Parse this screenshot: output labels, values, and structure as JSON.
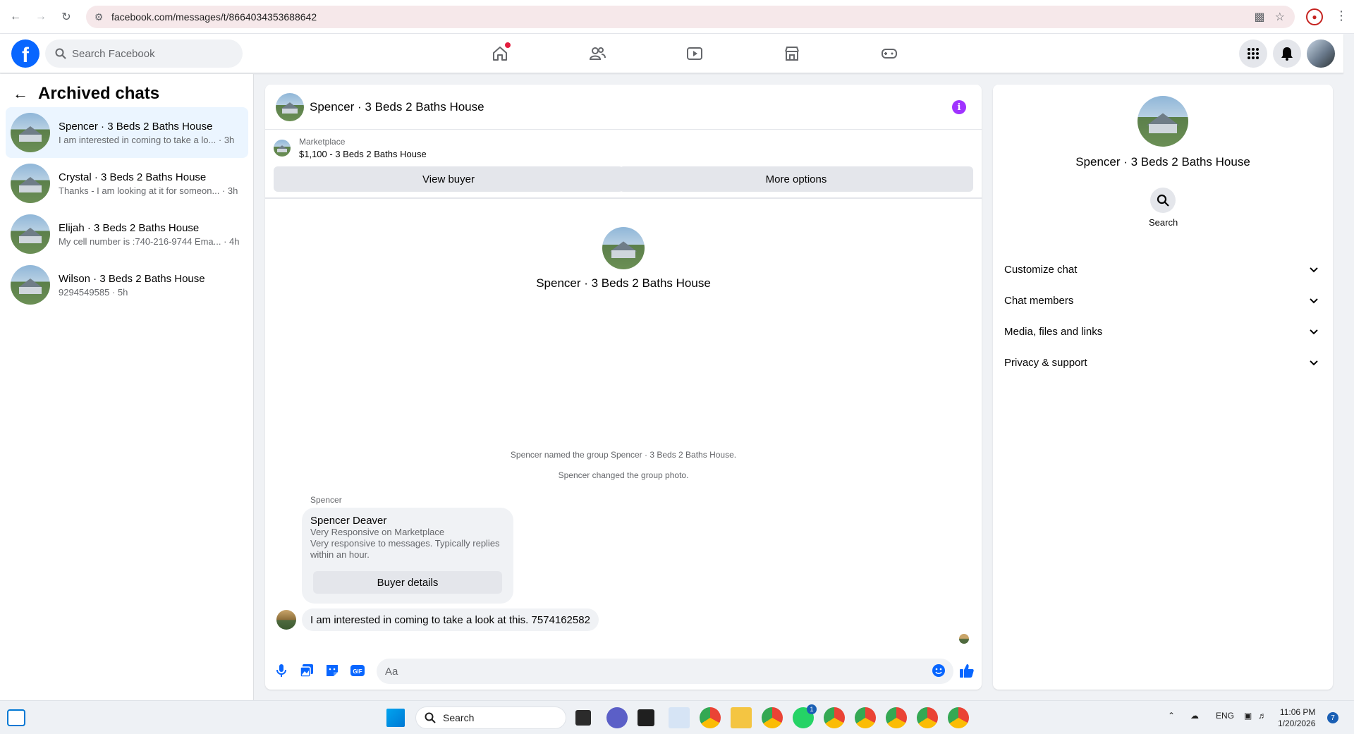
{
  "browser": {
    "url": "facebook.com/messages/t/8664034353688642"
  },
  "fbnav": {
    "search_placeholder": "Search Facebook",
    "brand_color": "#0866ff"
  },
  "sidebar": {
    "title": "Archived chats",
    "conversations": [
      {
        "title": "Spencer · 3 Beds 2 Baths House",
        "preview": "I am interested in coming to take a lo... · 3h",
        "active": true
      },
      {
        "title": "Crystal · 3 Beds 2 Baths House",
        "preview": "Thanks - I am looking at it for someon... · 3h",
        "active": false
      },
      {
        "title": "Elijah · 3 Beds 2 Baths House",
        "preview": "My cell number is :740-216-9744 Ema... · 4h",
        "active": false
      },
      {
        "title": "Wilson · 3 Beds 2 Baths House",
        "preview": "9294549585 · 5h",
        "active": false
      }
    ]
  },
  "chat": {
    "header_title": "Spencer · 3 Beds 2 Baths House",
    "marketplace_label": "Marketplace",
    "listing": "$1,100 - 3 Beds 2 Baths House",
    "view_buyer_label": "View buyer",
    "more_options_label": "More options",
    "center_name": "Spencer · 3 Beds 2 Baths House",
    "system_messages": [
      "Spencer named the group Spencer · 3 Beds 2 Baths House.",
      "Spencer changed the group photo."
    ],
    "sender_name": "Spencer",
    "card": {
      "name": "Spencer Deaver",
      "line1": "Very Responsive on Marketplace",
      "line2": "Very responsive to messages. Typically replies within an hour.",
      "button": "Buyer details"
    },
    "message": "I am interested in coming to take a look at this. 7574162582",
    "composer_placeholder": "Aa"
  },
  "right_panel": {
    "name": "Spencer · 3 Beds 2 Baths House",
    "search_label": "Search",
    "sections": [
      "Customize chat",
      "Chat members",
      "Media, files and links",
      "Privacy & support"
    ]
  },
  "taskbar": {
    "search_label": "Search",
    "language": "ENG",
    "time": "11:06 PM",
    "date": "1/20/2026",
    "notification_count": "7",
    "whatsapp_badge": "1"
  }
}
